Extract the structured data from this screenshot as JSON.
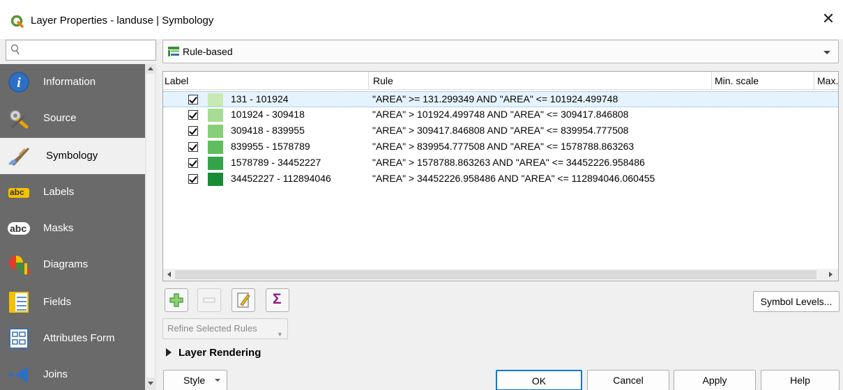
{
  "window": {
    "title": "Layer Properties - landuse | Symbology",
    "close_glyph": "✕"
  },
  "search": {
    "placeholder": "",
    "icon": "search-icon"
  },
  "sidebar": {
    "items": [
      {
        "label": "Information",
        "icon": "information-icon"
      },
      {
        "label": "Source",
        "icon": "source-icon"
      },
      {
        "label": "Symbology",
        "icon": "symbology-icon",
        "active": true
      },
      {
        "label": "Labels",
        "icon": "labels-icon"
      },
      {
        "label": "Masks",
        "icon": "masks-icon"
      },
      {
        "label": "Diagrams",
        "icon": "diagrams-icon"
      },
      {
        "label": "Fields",
        "icon": "fields-icon"
      },
      {
        "label": "Attributes Form",
        "icon": "attributes-form-icon"
      },
      {
        "label": "Joins",
        "icon": "joins-icon"
      }
    ],
    "labels_badge": "abc",
    "masks_badge": "abc"
  },
  "renderer": {
    "value": "Rule-based"
  },
  "tree": {
    "columns": [
      "Label",
      "Rule",
      "Min. scale",
      "Max."
    ],
    "rows": [
      {
        "checked": true,
        "color": "#c7e9b4",
        "label": "131 - 101924",
        "rule": "\"AREA\" >= 131.299349 AND \"AREA\" <= 101924.499748",
        "selected": true
      },
      {
        "checked": true,
        "color": "#a7dc95",
        "label": "101924 - 309418",
        "rule": "\"AREA\" > 101924.499748 AND \"AREA\" <= 309417.846808",
        "selected": false
      },
      {
        "checked": true,
        "color": "#86cf77",
        "label": "309418 - 839955",
        "rule": "\"AREA\" > 309417.846808 AND \"AREA\" <= 839954.777508",
        "selected": false
      },
      {
        "checked": true,
        "color": "#5ebd5c",
        "label": "839955 - 1578789",
        "rule": "\"AREA\" > 839954.777508 AND \"AREA\" <= 1578788.863263",
        "selected": false
      },
      {
        "checked": true,
        "color": "#33a548",
        "label": "1578789 - 34452227",
        "rule": "\"AREA\" > 1578788.863263 AND \"AREA\" <= 34452226.958486",
        "selected": false
      },
      {
        "checked": true,
        "color": "#178c36",
        "label": "34452227 - 112894046",
        "rule": "\"AREA\" > 34452226.958486 AND \"AREA\" <= 112894046.060455",
        "selected": false
      }
    ]
  },
  "toolbar": {
    "add": "add-rule-icon",
    "remove": "remove-rule-icon",
    "edit": "edit-rule-icon",
    "sigma": "Σ",
    "symbol_levels": "Symbol Levels..."
  },
  "refine": {
    "label": "Refine Selected Rules"
  },
  "layer_rendering": {
    "label": "Layer Rendering"
  },
  "footer": {
    "style": "Style",
    "ok": "OK",
    "cancel": "Cancel",
    "apply": "Apply",
    "help": "Help"
  },
  "colors": {
    "sidebar_bg": "#6a6a6a",
    "accent": "#0078d7",
    "selection": "#e5f3ff"
  }
}
